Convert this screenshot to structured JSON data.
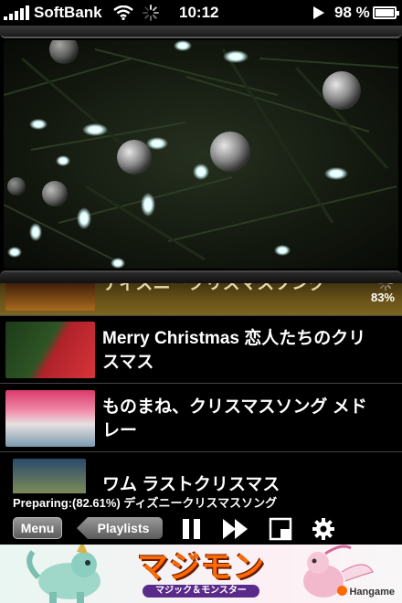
{
  "status_bar": {
    "carrier": "SoftBank",
    "time": "10:12",
    "battery": "98 %"
  },
  "playlist": [
    {
      "title": "ディズニークリスマスソング",
      "progress": "83%",
      "active": true
    },
    {
      "title": "Merry Christmas 恋人たちのクリスマス",
      "active": false
    },
    {
      "title": "ものまね、クリスマスソング メドレー",
      "active": false
    },
    {
      "title": "ワム ラストクリスマス",
      "active": false
    }
  ],
  "status_text": "Preparing:(82.61%) ディズニークリスマスソング",
  "toolbar": {
    "menu_label": "Menu",
    "playlists_label": "Playlists"
  },
  "ad": {
    "logo": "マジモン",
    "subtitle": "マジック＆モンスター",
    "brand": "Hangame"
  },
  "colors": {
    "active_row": "#6a5418",
    "button": "#7a7a7a",
    "ad_logo": "#ff6a00"
  }
}
